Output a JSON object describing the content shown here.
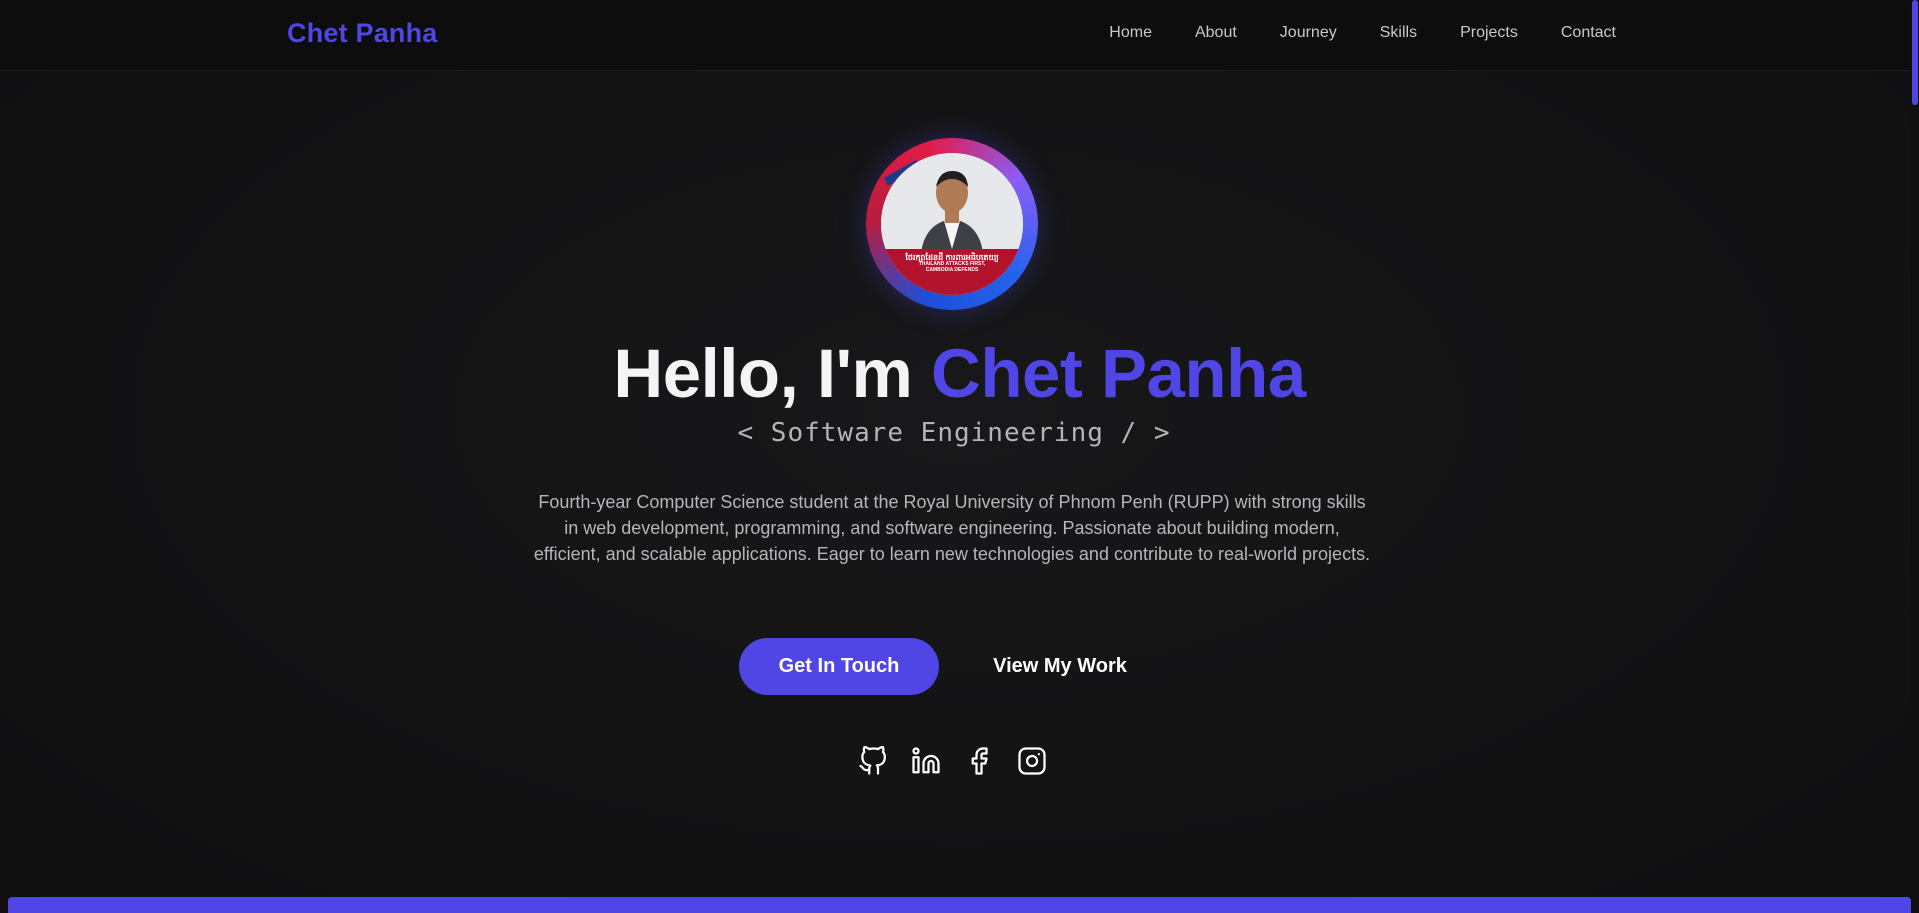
{
  "header": {
    "brand": "Chet Panha",
    "nav": [
      "Home",
      "About",
      "Journey",
      "Skills",
      "Projects",
      "Contact"
    ]
  },
  "hero": {
    "avatar": {
      "caption_line1": "ថែរក្សាដែនដី ការពារអធិបតេយ្យ",
      "caption_line2": "THAILAND ATTACKS FIRST,",
      "caption_line3": "CAMBODIA DEFENDS"
    },
    "greeting": "Hello, I'm ",
    "name": "Chet Panha",
    "subtitle": "< Software Engineering / >",
    "description": "Fourth-year Computer Science student at the Royal University of Phnom Penh (RUPP) with strong skills in web development, programming, and software engineering. Passionate about building modern, efficient, and scalable applications. Eager to learn new technologies and contribute to real-world projects.",
    "primary_button": "Get In Touch",
    "secondary_button": "View My Work"
  },
  "social": [
    {
      "icon": "github-icon"
    },
    {
      "icon": "linkedin-icon"
    },
    {
      "icon": "facebook-icon"
    },
    {
      "icon": "instagram-icon"
    }
  ],
  "colors": {
    "accent": "#4f46e5",
    "background": "#131314",
    "text": "#f4f4f5",
    "muted": "#b6b6ba"
  }
}
